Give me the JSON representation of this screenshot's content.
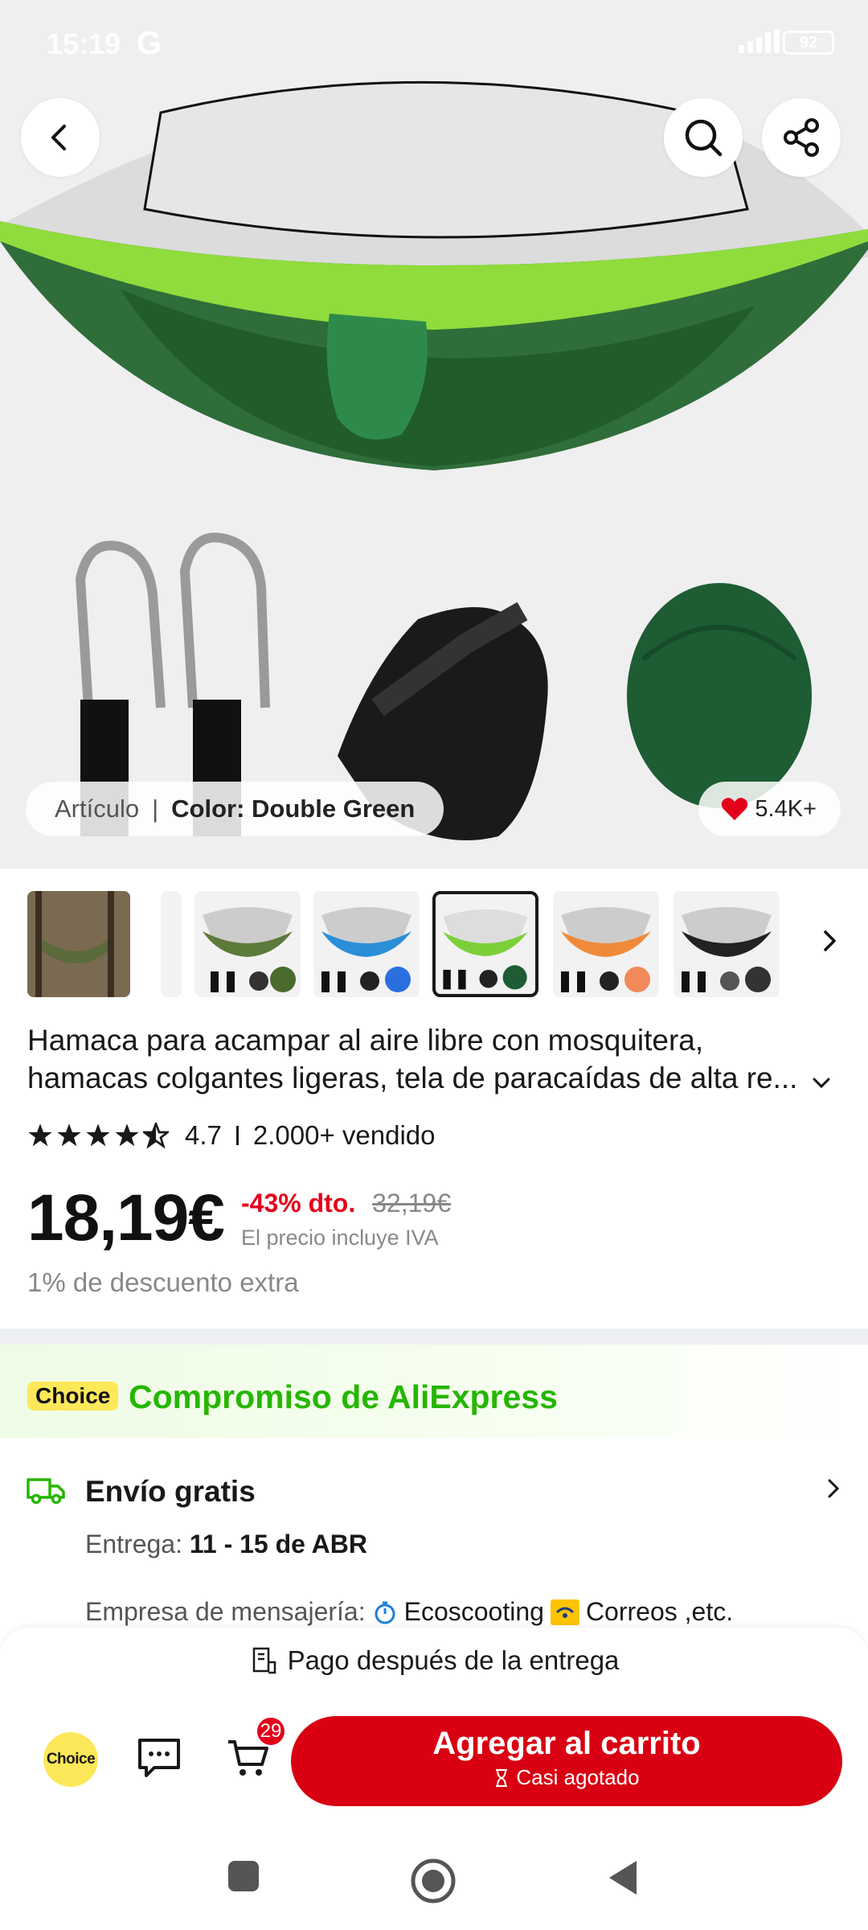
{
  "status_bar": {
    "time": "15:19",
    "carrier_icon": "G",
    "network": "4G",
    "battery": "92"
  },
  "hero": {
    "variant_label": "Artículo",
    "variant_value": "Color: Double Green",
    "favorites": "5.4K+"
  },
  "thumbnails": [
    {
      "name": "thumb-forest"
    },
    {
      "name": "thumb-partial"
    },
    {
      "name": "thumb-camo-green"
    },
    {
      "name": "thumb-blue"
    },
    {
      "name": "thumb-double-green",
      "selected": true
    },
    {
      "name": "thumb-orange"
    },
    {
      "name": "thumb-black"
    }
  ],
  "product": {
    "title_line1": "Hamaca para acampar al aire libre con mosquitera,",
    "title_line2": "hamacas colgantes ligeras, tela de paracaídas de alta re...",
    "rating": "4.7",
    "sold": "2.000+ vendido",
    "price": "18,19€",
    "discount": "-43% dto.",
    "old_price": "32,19€",
    "iva_note": "El precio incluye IVA",
    "extra_discount": "1% de descuento extra"
  },
  "choice": {
    "tag": "Choice",
    "title": "Compromiso de AliExpress"
  },
  "shipping": {
    "title": "Envío gratis",
    "delivery_label": "Entrega:",
    "delivery_value": "11 - 15 de ABR",
    "courier_label": "Empresa de mensajería:",
    "courier_1": "Ecoscooting",
    "courier_2": "Correos ,etc."
  },
  "bottom": {
    "pay_after": "Pago después de la entrega",
    "choice_badge": "Choice",
    "cart_count": "29",
    "cta_main": "Agregar al carrito",
    "cta_sub": "Casi agotado"
  },
  "colors": {
    "brand_red": "#d80012",
    "choice_green": "#26b600",
    "choice_yellow": "#fde85a",
    "sale_red": "#e3001b"
  }
}
